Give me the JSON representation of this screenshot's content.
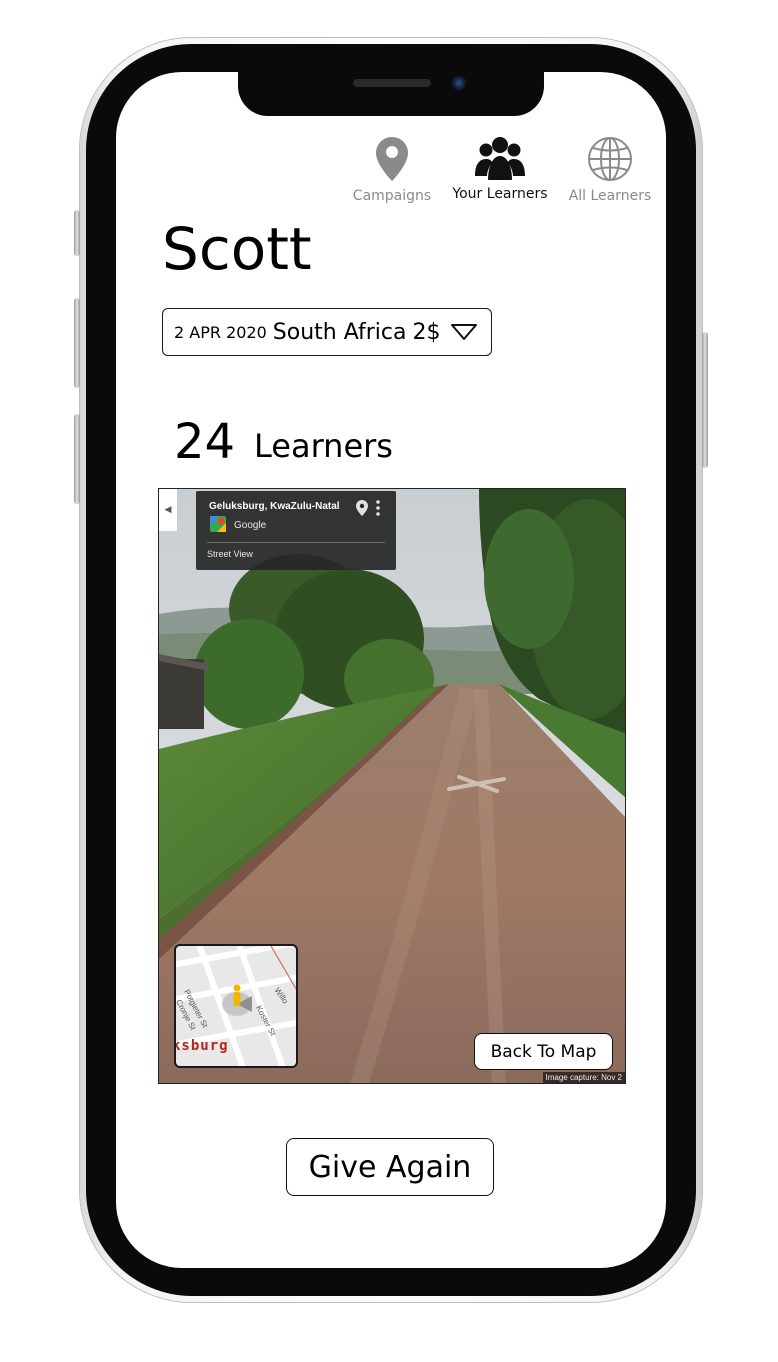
{
  "nav": {
    "items": [
      {
        "label": "Campaigns",
        "icon": "map-pin-icon",
        "active": false
      },
      {
        "label": "Your Learners",
        "icon": "users-group-icon",
        "active": true
      },
      {
        "label": "All Learners",
        "icon": "globe-icon",
        "active": false
      }
    ]
  },
  "profile": {
    "name": "Scott"
  },
  "campaign_select": {
    "date": "2 APR 2020",
    "country": "South Africa",
    "amount": "2$",
    "icon": "triangle-down-icon"
  },
  "learners": {
    "count": "24",
    "label": "Learners"
  },
  "street_view": {
    "location_title": "Geluksburg, KwaZulu-Natal",
    "brand": "Google",
    "mode_label": "Street View",
    "mini_map": {
      "streets": [
        "Potgieter St",
        "Cronje St",
        "Koster St",
        "Willo"
      ],
      "town_label": "ksburg"
    },
    "back_button_label": "Back To Map",
    "capture_note": "Image capture: Nov 2"
  },
  "actions": {
    "give_again_label": "Give Again"
  },
  "colors": {
    "active_nav": "#111111",
    "inactive_nav": "#8a8a8a",
    "town_label": "#b3261e"
  }
}
